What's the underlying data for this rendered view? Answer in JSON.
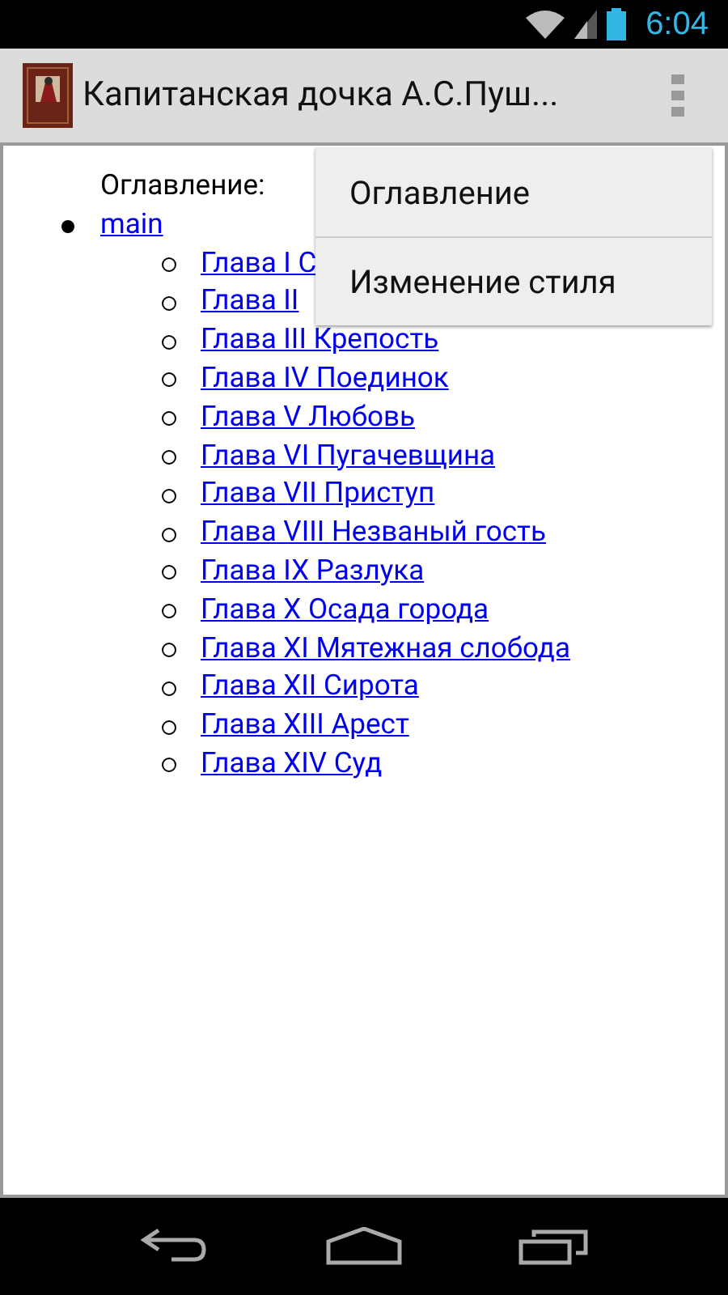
{
  "status_bar": {
    "time": "6:04"
  },
  "action_bar": {
    "title": "Капитанская дочка А.С.Пуш..."
  },
  "content": {
    "heading": "Оглавление:",
    "tree": [
      {
        "label": "main",
        "children": [
          {
            "label": "Глава I С"
          },
          {
            "label": "Глава II"
          },
          {
            "label": "Глава III Крепость"
          },
          {
            "label": "Глава IV Поединок"
          },
          {
            "label": "Глава V Любовь"
          },
          {
            "label": "Глава VI Пугачевщина"
          },
          {
            "label": "Глава VII Приступ"
          },
          {
            "label": "Глава VIII Незваный гость"
          },
          {
            "label": "Глава IX Разлука"
          },
          {
            "label": "Глава X Осада города"
          },
          {
            "label": "Глава XI Мятежная слобода"
          },
          {
            "label": "Глава XII Сирота"
          },
          {
            "label": "Глава XIII Арест"
          },
          {
            "label": "Глава XIV Суд"
          }
        ]
      }
    ]
  },
  "overflow_menu": {
    "items": [
      {
        "label": "Оглавление"
      },
      {
        "label": "Изменение стиля"
      }
    ]
  }
}
